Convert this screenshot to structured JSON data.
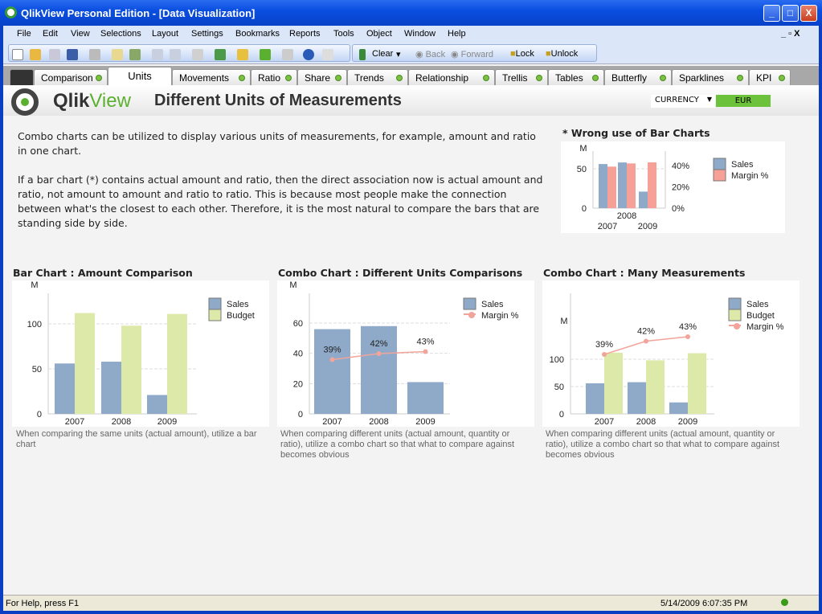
{
  "window": {
    "title": "QlikView Personal Edition - [Data Visualization]",
    "minimize": "_",
    "maximize": "□",
    "close": "X"
  },
  "menu": [
    "File",
    "Edit",
    "View",
    "Selections",
    "Layout",
    "Settings",
    "Bookmarks",
    "Reports",
    "Tools",
    "Object",
    "Window",
    "Help"
  ],
  "mdi_controls": "_ ▫ X",
  "toolbar": {
    "clear": "Clear",
    "back": "Back",
    "forward": "Forward",
    "lock": "Lock",
    "unlock": "Unlock"
  },
  "tabs": [
    {
      "label": "Comparison"
    },
    {
      "label": "Units",
      "active": true
    },
    {
      "label": "Movements"
    },
    {
      "label": "Ratio"
    },
    {
      "label": "Share"
    },
    {
      "label": "Trends"
    },
    {
      "label": "Relationship"
    },
    {
      "label": "Trellis"
    },
    {
      "label": "Tables"
    },
    {
      "label": "Butterfly"
    },
    {
      "label": "Sparklines"
    },
    {
      "label": "KPI"
    }
  ],
  "header": {
    "brand_a": "Qlik",
    "brand_b": "View",
    "title": "Different Units of Measurements",
    "currency_label": "CURRENCY",
    "currency_value": "EUR"
  },
  "intro": {
    "p1": "Combo charts can be utilized to display various units of measurements, for example, amount and ratio in one chart.",
    "p2": "If a bar chart (*) contains actual amount and ratio, then the direct association now is actual amount and ratio, not amount to amount and ratio to ratio. This is because most people make the connection between what's the closest to each other. Therefore, it is the most natural to compare the bars that are standing side by side."
  },
  "colors": {
    "sales": "#8fa9c9",
    "budget": "#dde9a8",
    "margin_bar": "#f7a097",
    "margin_line": "#f2a49a",
    "accent": "#6cc23a"
  },
  "chart_data": [
    {
      "id": "wrong",
      "type": "bar",
      "title": "* Wrong use of Bar Charts",
      "ylabel": "M",
      "categories": [
        "2007",
        "2008",
        "2009"
      ],
      "series": [
        {
          "name": "Sales",
          "values": [
            56,
            58,
            21
          ],
          "axis": "left"
        },
        {
          "name": "Margin %",
          "values": [
            39,
            42,
            43
          ],
          "axis": "right"
        }
      ],
      "yticks": [
        "0",
        "50"
      ],
      "y2ticks": [
        "0%",
        "20%",
        "40%"
      ],
      "grid": true,
      "legend": "right"
    },
    {
      "id": "bar",
      "type": "bar",
      "title": "Bar Chart : Amount Comparison",
      "ylabel": "M",
      "categories": [
        "2007",
        "2008",
        "2009"
      ],
      "series": [
        {
          "name": "Sales",
          "values": [
            56,
            58,
            21
          ]
        },
        {
          "name": "Budget",
          "values": [
            112,
            98,
            111
          ]
        }
      ],
      "yticks": [
        "0",
        "50",
        "100"
      ],
      "grid": true,
      "legend": "right",
      "caption": "When comparing the same units (actual amount), utilize a bar chart"
    },
    {
      "id": "combo1",
      "type": "combo",
      "title": "Combo Chart : Different Units Comparisons",
      "ylabel": "M",
      "categories": [
        "2007",
        "2008",
        "2009"
      ],
      "series": [
        {
          "name": "Sales",
          "type": "bar",
          "values": [
            56,
            58,
            21
          ]
        },
        {
          "name": "Margin %",
          "type": "line",
          "values": [
            39,
            42,
            43
          ],
          "labels": [
            "39%",
            "42%",
            "43%"
          ]
        }
      ],
      "yticks": [
        "0",
        "20",
        "40",
        "60"
      ],
      "grid": true,
      "legend": "right",
      "caption": "When comparing different units (actual amount, quantity or ratio), utilize a combo chart so that what to compare against becomes obvious"
    },
    {
      "id": "combo2",
      "type": "combo",
      "title": "Combo Chart : Many Measurements",
      "ylabel": "M",
      "categories": [
        "2007",
        "2008",
        "2009"
      ],
      "series": [
        {
          "name": "Sales",
          "type": "bar",
          "values": [
            56,
            58,
            21
          ]
        },
        {
          "name": "Budget",
          "type": "bar",
          "values": [
            112,
            98,
            111
          ]
        },
        {
          "name": "Margin %",
          "type": "line",
          "values": [
            39,
            42,
            43
          ],
          "labels": [
            "39%",
            "42%",
            "43%"
          ]
        }
      ],
      "yticks": [
        "0",
        "50",
        "100"
      ],
      "grid": true,
      "legend": "right",
      "caption": "When comparing different units (actual amount, quantity or ratio), utilize a combo chart so that what to compare against becomes obvious"
    }
  ],
  "status": {
    "help": "For Help, press F1",
    "datetime": "5/14/2009 6:07:35 PM"
  }
}
